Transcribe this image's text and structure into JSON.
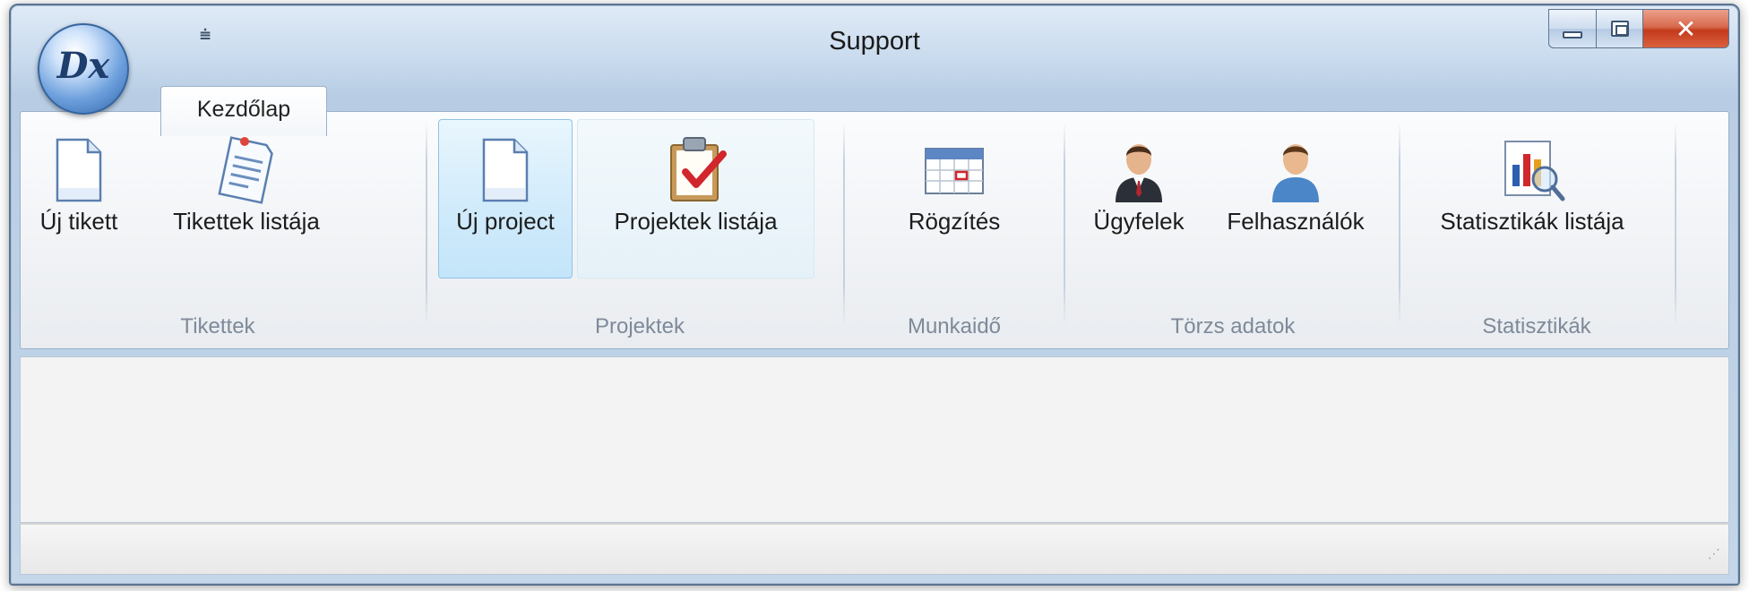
{
  "window": {
    "title": "Support"
  },
  "app_menu": {
    "logo_text": "Dx"
  },
  "quick_access": {
    "glyph": "⩧"
  },
  "tabs": [
    {
      "label": "Kezdőlap",
      "active": true
    }
  ],
  "ribbon": {
    "groups": [
      {
        "label": "Tikettek",
        "buttons": [
          {
            "label": "Új tikett",
            "icon": "new-document-icon"
          },
          {
            "label": "Tikettek listája",
            "icon": "notes-list-icon"
          }
        ]
      },
      {
        "label": "Projektek",
        "buttons": [
          {
            "label": "Új project",
            "icon": "new-document-icon"
          },
          {
            "label": "Projektek listája",
            "icon": "clipboard-check-icon"
          }
        ]
      },
      {
        "label": "Munkaidő",
        "buttons": [
          {
            "label": "Rögzítés",
            "icon": "calendar-icon"
          }
        ]
      },
      {
        "label": "Törzs adatok",
        "buttons": [
          {
            "label": "Ügyfelek",
            "icon": "customer-icon"
          },
          {
            "label": "Felhasználók",
            "icon": "user-icon"
          }
        ]
      },
      {
        "label": "Statisztikák",
        "buttons": [
          {
            "label": "Statisztikák listája",
            "icon": "chart-magnifier-icon"
          }
        ]
      }
    ]
  },
  "colors": {
    "accent_hover": "#cfeafb",
    "close_button": "#c4391b",
    "frame": "#5b7591"
  }
}
